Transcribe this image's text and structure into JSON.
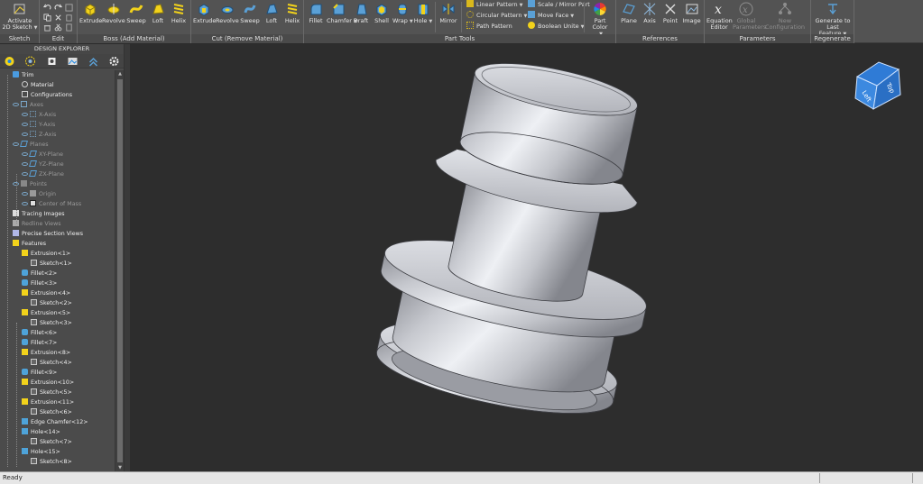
{
  "ribbon": {
    "groups": [
      {
        "label": "Sketch"
      },
      {
        "label": "Edit"
      },
      {
        "label": "Boss (Add Material)"
      },
      {
        "label": "Cut (Remove Material)"
      },
      {
        "label": "Part Tools"
      },
      {
        "label": "References"
      },
      {
        "label": "Parameters"
      },
      {
        "label": "Regenerate"
      }
    ],
    "sketch": {
      "activate_line1": "Activate",
      "activate_line2": "2D Sketch"
    },
    "boss": {
      "extrude": "Extrude",
      "revolve": "Revolve",
      "sweep": "Sweep",
      "loft": "Loft",
      "helix": "Helix"
    },
    "cut": {
      "extrude": "Extrude",
      "revolve": "Revolve",
      "sweep": "Sweep",
      "loft": "Loft",
      "helix": "Helix"
    },
    "part_tools": {
      "fillet": "Fillet",
      "chamfer": "Chamfer",
      "draft": "Draft",
      "shell": "Shell",
      "wrap": "Wrap",
      "hole": "Hole",
      "mirror": "Mirror",
      "linear_pattern": "Linear Pattern",
      "circular_pattern": "Circular Pattern",
      "path_pattern": "Path Pattern",
      "scale_mirror": "Scale / Mirror Part",
      "move_face": "Move Face",
      "boolean_unite": "Boolean Unite",
      "part_color_line1": "Part Color"
    },
    "references": {
      "plane": "Plane",
      "axis": "Axis",
      "point": "Point",
      "image": "Image"
    },
    "parameters": {
      "eq_line1": "Equation",
      "eq_line2": "Editor",
      "global_line1": "Global",
      "global_line2": "Parameters",
      "new_config": "New Configuration"
    },
    "regenerate": {
      "line1": "Generate to",
      "line2": "Last Feature"
    }
  },
  "explorer": {
    "title": "DESIGN EXPLORER",
    "tree": [
      {
        "label": "Trim",
        "dim": false
      },
      {
        "label": "Material",
        "dim": false
      },
      {
        "label": "Configurations",
        "dim": false
      },
      {
        "label": "Axes",
        "dim": true
      },
      {
        "label": "X-Axis",
        "dim": true
      },
      {
        "label": "Y-Axis",
        "dim": true
      },
      {
        "label": "Z-Axis",
        "dim": true
      },
      {
        "label": "Planes",
        "dim": true
      },
      {
        "label": "XY-Plane",
        "dim": true
      },
      {
        "label": "YZ-Plane",
        "dim": true
      },
      {
        "label": "ZX-Plane",
        "dim": true
      },
      {
        "label": "Points",
        "dim": true
      },
      {
        "label": "Origin",
        "dim": true
      },
      {
        "label": "Center of Mass",
        "dim": true
      },
      {
        "label": "Tracing Images",
        "dim": false
      },
      {
        "label": "Redline Views",
        "dim": true
      },
      {
        "label": "Precise Section Views",
        "dim": false
      },
      {
        "label": "Features",
        "dim": false
      },
      {
        "label": "Extrusion<1>",
        "dim": false
      },
      {
        "label": "Sketch<1>",
        "dim": false
      },
      {
        "label": "Fillet<2>",
        "dim": false
      },
      {
        "label": "Fillet<3>",
        "dim": false
      },
      {
        "label": "Extrusion<4>",
        "dim": false
      },
      {
        "label": "Sketch<2>",
        "dim": false
      },
      {
        "label": "Extrusion<5>",
        "dim": false
      },
      {
        "label": "Sketch<3>",
        "dim": false
      },
      {
        "label": "Fillet<6>",
        "dim": false
      },
      {
        "label": "Fillet<7>",
        "dim": false
      },
      {
        "label": "Extrusion<8>",
        "dim": false
      },
      {
        "label": "Sketch<4>",
        "dim": false
      },
      {
        "label": "Fillet<9>",
        "dim": false
      },
      {
        "label": "Extrusion<10>",
        "dim": false
      },
      {
        "label": "Sketch<5>",
        "dim": false
      },
      {
        "label": "Extrusion<11>",
        "dim": false
      },
      {
        "label": "Sketch<6>",
        "dim": false
      },
      {
        "label": "Edge Chamfer<12>",
        "dim": false
      },
      {
        "label": "Hole<14>",
        "dim": false
      },
      {
        "label": "Sketch<7>",
        "dim": false
      },
      {
        "label": "Hole<15>",
        "dim": false
      },
      {
        "label": "Sketch<8>",
        "dim": false
      }
    ]
  },
  "viewcube": {
    "left": "Left",
    "top": "Top"
  },
  "status": {
    "text": "Ready"
  },
  "colors": {
    "accent_yellow": "#f2d21b",
    "viewcube_blue": "#2f7bd6",
    "part_gray": "#c7c9cf"
  }
}
